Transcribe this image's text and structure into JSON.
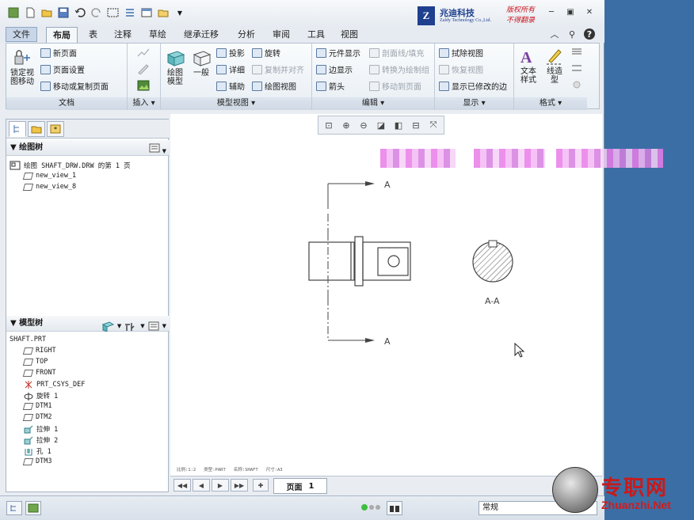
{
  "app": {
    "logo": {
      "mark": "Z",
      "company": "兆迪科技",
      "english": "Zaldy Technology Co.,Ltd.",
      "slogan1": "版权所有",
      "slogan2": "不得翻录"
    }
  },
  "tabs": {
    "file": "文件",
    "items": [
      "布局",
      "表",
      "注释",
      "草绘",
      "继承迁移",
      "分析",
      "审阅",
      "工具",
      "视图"
    ],
    "active": "布局"
  },
  "ribbon": {
    "doc": {
      "lock_move": "锁定视图移动",
      "new_page": "新页面",
      "page_setup": "页面设置",
      "move_copy": "移动或复制页面",
      "label": "文档"
    },
    "insert": {
      "label": "插入"
    },
    "model_views": {
      "drawing_model": "绘图模型",
      "general": "一般",
      "projection": "投影",
      "detail": "详细",
      "auxiliary": "辅助",
      "revolve": "旋转",
      "copy_align": "复制并对齐",
      "drawing_view": "绘图视图",
      "label": "模型视图"
    },
    "edit": {
      "element_display": "元件显示",
      "edge_display": "边显示",
      "arrow": "箭头",
      "hatch": "剖面线/填充",
      "convert": "转换为绘制组",
      "move_to_page": "移动到页面",
      "label": "编辑"
    },
    "display": {
      "erase_view": "拭除视图",
      "restore_view": "恢复视图",
      "show_modified": "显示已修改的边",
      "label": "显示"
    },
    "format": {
      "text_style": "文本样式",
      "line_style": "线造型",
      "label": "格式"
    }
  },
  "drawing_tree": {
    "title": "绘图树",
    "root": "绘图 SHAFT_DRW.DRW 的第 1 页",
    "views": [
      "new_view_1",
      "new_view_8"
    ]
  },
  "model_tree": {
    "title": "模型树",
    "part": "SHAFT.PRT",
    "items": [
      "RIGHT",
      "TOP",
      "FRONT",
      "PRT_CSYS_DEF",
      "旋转 1",
      "DTM1",
      "DTM2",
      "拉伸 1",
      "拉伸 2",
      "孔 1",
      "DTM3"
    ]
  },
  "canvas": {
    "section_a1": "A",
    "section_a2": "A",
    "section_label": "A-A",
    "status": [
      "比例:1:2",
      "类型:PART",
      "名称:SHAFT",
      "尺寸:A3"
    ]
  },
  "pagebar": {
    "page_label": "页面",
    "page_num": "1"
  },
  "statusbar": {
    "filter": "常规"
  },
  "watermark": {
    "cn": "专职网",
    "en": "Zhuanzhi.Net"
  },
  "colors": {
    "accent": "#3b6ea5",
    "logo_blue": "#1f3f8f",
    "logo_red": "#c8141e",
    "blur": "#e87ce8"
  }
}
